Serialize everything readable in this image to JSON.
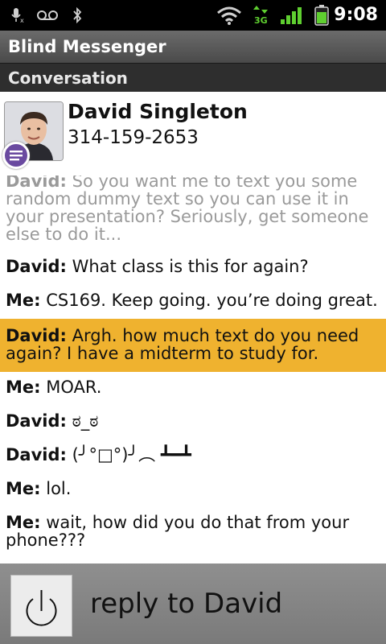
{
  "status_bar": {
    "time": "9:08",
    "icons": [
      "mic-muted-icon",
      "voicemail-icon",
      "bluetooth-icon",
      "wifi-icon",
      "3g-data-icon",
      "signal-icon",
      "battery-icon"
    ],
    "network": "3G"
  },
  "app": {
    "title": "Blind Messenger",
    "subtitle": "Conversation"
  },
  "contact": {
    "name": "David Singleton",
    "phone": "314-159-2653"
  },
  "messages": [
    {
      "sender": "David:",
      "text": "So you want me to text you some random dummy text so you can use it in your presentation? Seriously, get someone else to do it..."
    },
    {
      "sender": "David:",
      "text": "What class is this for again?"
    },
    {
      "sender": "Me:",
      "text": "CS169. Keep going. you’re doing great."
    },
    {
      "sender": "David:",
      "text": "Argh. how much text do you need again? I have a midterm to study for."
    },
    {
      "sender": "Me:",
      "text": "MOAR."
    },
    {
      "sender": "David:",
      "text": "ಠ_ಠ"
    },
    {
      "sender": "David:",
      "text": "(╯°□°)╯︵ ┻━┻"
    },
    {
      "sender": "Me:",
      "text": "lol."
    },
    {
      "sender": "Me:",
      "text": "wait, how did you do that from your phone???"
    }
  ],
  "footer": {
    "reply_label": "reply to David",
    "button_icon": "power-icon"
  },
  "colors": {
    "highlight": "#efb22f",
    "status_bar": "#000000",
    "title_bar": "#595959",
    "footer": "#858585",
    "badge": "#6a4aa0"
  }
}
